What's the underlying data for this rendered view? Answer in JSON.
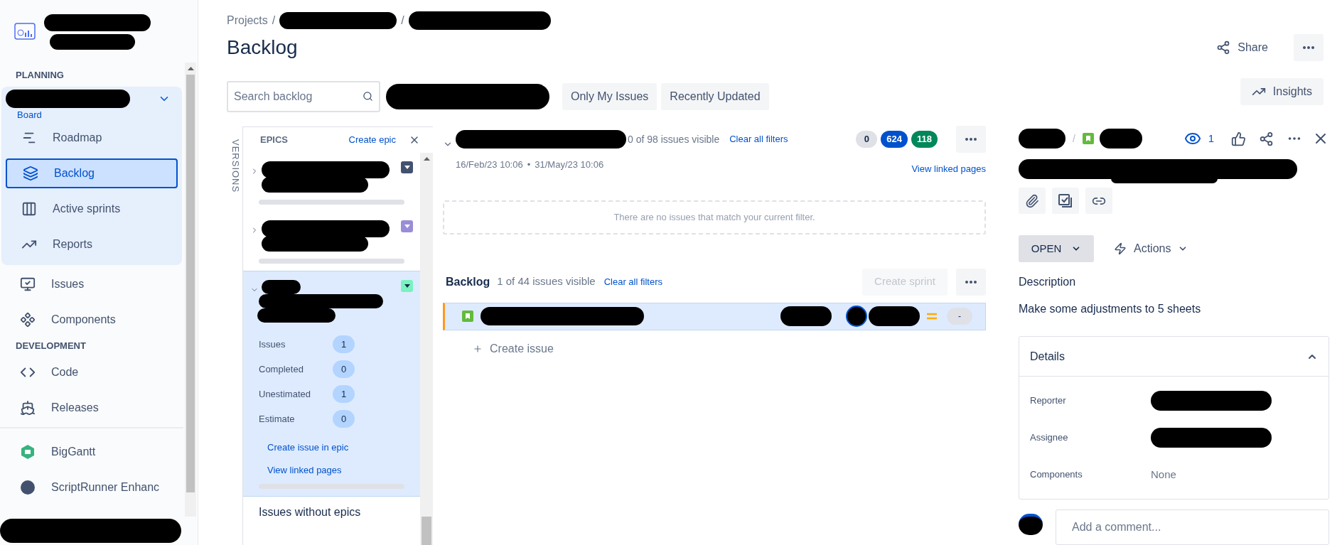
{
  "sidebar": {
    "sections": [
      {
        "heading": "PLANNING",
        "board": {
          "label": "Board",
          "expanded": true
        },
        "items": [
          {
            "label": "Roadmap",
            "kind": "roadmap",
            "selected": false
          },
          {
            "label": "Backlog",
            "kind": "backlog",
            "selected": true
          },
          {
            "label": "Active sprints",
            "kind": "columns",
            "selected": false
          },
          {
            "label": "Reports",
            "kind": "chart",
            "selected": false
          }
        ]
      },
      {
        "items": [
          {
            "label": "Issues",
            "kind": "issues",
            "selected": false
          },
          {
            "label": "Components",
            "kind": "components",
            "selected": false
          }
        ]
      },
      {
        "heading": "DEVELOPMENT",
        "items": [
          {
            "label": "Code",
            "kind": "code",
            "selected": false
          },
          {
            "label": "Releases",
            "kind": "ship",
            "selected": false
          }
        ]
      },
      {
        "items": [
          {
            "label": "BigGantt",
            "kind": "gantt",
            "selected": false
          },
          {
            "label": "ScriptRunner Enhanc",
            "kind": "app",
            "selected": false
          }
        ]
      }
    ]
  },
  "breadcrumbs": [
    "Projects",
    "/",
    "/"
  ],
  "title": "Backlog",
  "share": "Share",
  "search": {
    "placeholder": "Search backlog"
  },
  "quick_filters": [
    {
      "label": "Only My Issues",
      "selected": false
    },
    {
      "label": "Recently Updated",
      "selected": false
    }
  ],
  "insights": "Insights",
  "versions_tab": "VERSIONS",
  "epics": {
    "title": "EPICS",
    "create": "Create epic",
    "items": [
      {
        "color": "#42526e",
        "expanded": false
      },
      {
        "color": "#998dd9",
        "expanded": false
      },
      {
        "color": "#79f2c0",
        "expanded": true,
        "stats": [
          {
            "label": "Issues",
            "value": "1"
          },
          {
            "label": "Completed",
            "value": "0"
          },
          {
            "label": "Unestimated",
            "value": "1"
          },
          {
            "label": "Estimate",
            "value": "0"
          }
        ],
        "links": [
          "Create issue in epic",
          "View linked pages"
        ]
      }
    ],
    "without": "Issues without epics"
  },
  "sprint": {
    "visible": "0 of 98 issues visible",
    "clear": "Clear all filters",
    "start": "16/Feb/23 10:06",
    "separator": "•",
    "end": "31/May/23 10:06",
    "counts": [
      {
        "value": "0",
        "color": "#dfe1e6"
      },
      {
        "value": "624",
        "color": "#0052cc"
      },
      {
        "value": "118",
        "color": "#00875a"
      }
    ],
    "linked": "View linked pages",
    "empty": "There are no issues that match your current filter."
  },
  "backlog": {
    "title": "Backlog",
    "visible": "1 of 44 issues visible",
    "clear": "Clear all filters",
    "create_sprint": {
      "label": "Create sprint",
      "disabled": true
    },
    "issues": [
      {
        "selected": true,
        "estimate": "-"
      }
    ],
    "create_issue": "Create issue"
  },
  "detail": {
    "separator": "/",
    "watchers": "1",
    "status": "OPEN",
    "actions": "Actions",
    "description_label": "Description",
    "description": "Make some adjustments to 5 sheets",
    "details": {
      "title": "Details",
      "expanded": true,
      "fields": [
        {
          "label": "Reporter",
          "kind": "user"
        },
        {
          "label": "Assignee",
          "kind": "user"
        },
        {
          "label": "Components",
          "kind": "text",
          "value": "None"
        }
      ]
    },
    "comment": {
      "placeholder": "Add a comment..."
    }
  }
}
